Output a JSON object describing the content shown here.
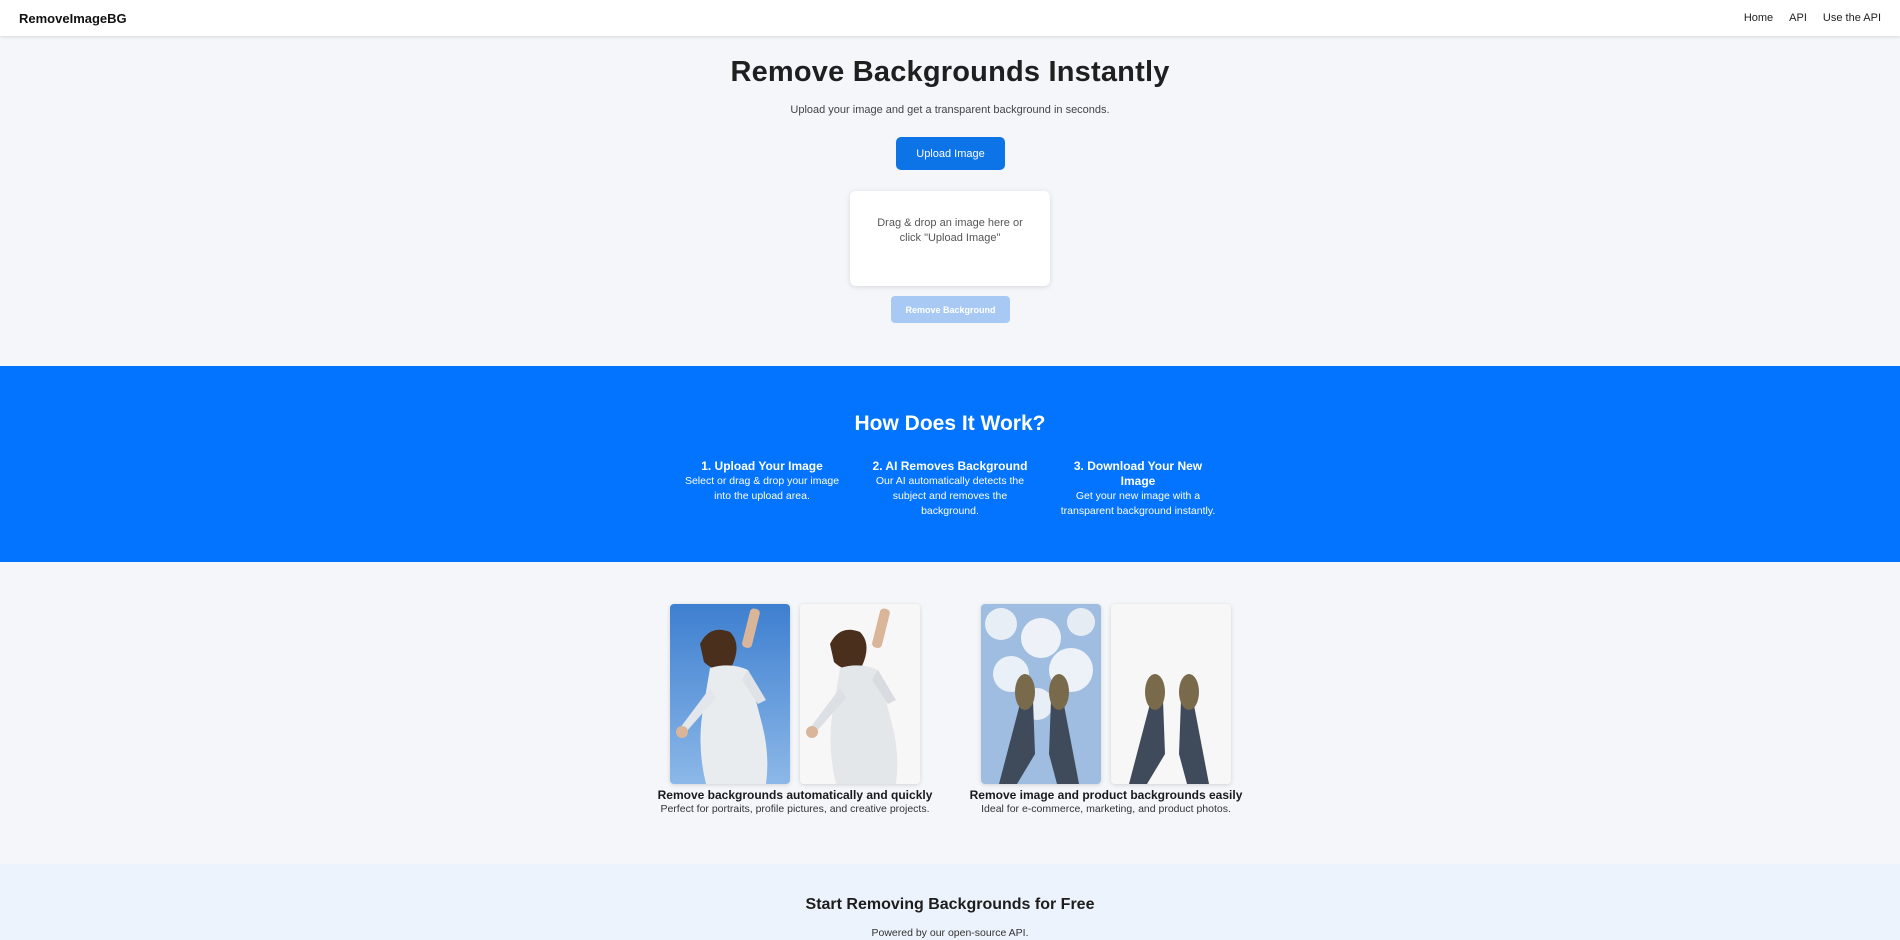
{
  "nav": {
    "brand": "RemoveImageBG",
    "links": [
      "Home",
      "API",
      "Use the API"
    ]
  },
  "hero": {
    "title": "Remove Backgrounds Instantly",
    "subtitle": "Upload your image and get a transparent background in seconds.",
    "upload_label": "Upload Image",
    "dropzone_text": "Drag & drop an image here or click \"Upload Image\"",
    "remove_label": "Remove Background"
  },
  "how": {
    "title": "How Does It Work?",
    "steps": [
      {
        "title": "1. Upload Your Image",
        "text": "Select or drag & drop your image into the upload area."
      },
      {
        "title": "2. AI Removes Background",
        "text": "Our AI automatically detects the subject and removes the background."
      },
      {
        "title": "3. Download Your New Image",
        "text": "Get your new image with a transparent background instantly."
      }
    ]
  },
  "examples": [
    {
      "title": "Remove backgrounds automatically and quickly",
      "text": "Perfect for portraits, profile pictures, and creative projects."
    },
    {
      "title": "Remove image and product backgrounds easily",
      "text": "Ideal for e-commerce, marketing, and product photos."
    }
  ],
  "cta": {
    "title": "Start Removing Backgrounds for Free",
    "text": "Powered by our open-source API."
  },
  "colors": {
    "accent": "#0274ff",
    "button": "#0d74e8",
    "button_disabled": "#a9c9f5"
  }
}
